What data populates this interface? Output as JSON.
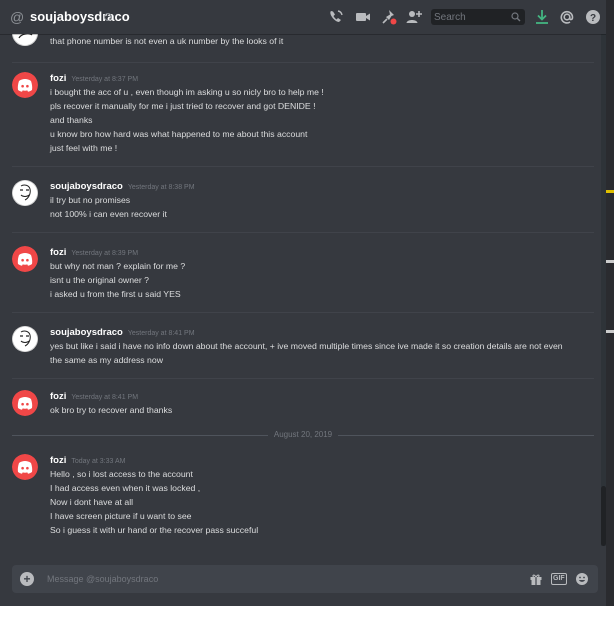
{
  "header": {
    "channel_name": "soujaboysdraco",
    "search_placeholder": "Search",
    "icons": [
      "at-icon",
      "status-icon",
      "phone-call-icon",
      "video-call-icon",
      "pin-icon",
      "add-friend-icon",
      "search-icon",
      "download-icon",
      "mentions-icon",
      "help-icon"
    ]
  },
  "messages": {
    "top_fragment": "that phone number is not even  a uk number by the looks of it",
    "groups": [
      {
        "author": "fozi",
        "timestamp": "Yesterday at 8:37 PM",
        "lines": [
          "i bought the acc of u , even though im asking u so nicly bro to help me !",
          "pls recover it manually for me i just tried to recover and got DENIDE  !",
          "and thanks",
          "u know bro how hard was what happened to me about this account",
          "just feel with me !"
        ]
      },
      {
        "author": "soujaboysdraco",
        "timestamp": "Yesterday at 8:38 PM",
        "lines": [
          "il try but no promises",
          "not 100% i can even recover it"
        ]
      },
      {
        "author": "fozi",
        "timestamp": "Yesterday at 8:39 PM",
        "lines": [
          "but why not man ? explain for me ?",
          "isnt u the original owner ?",
          "i asked u from the first u said YES"
        ]
      },
      {
        "author": "soujaboysdraco",
        "timestamp": "Yesterday at 8:41 PM",
        "lines": [
          "yes but like i said i have no info down about the account, + ive moved multiple times since ive made it so creation details are not even the same as my address now"
        ]
      },
      {
        "author": "fozi",
        "timestamp": "Yesterday at 8:41 PM",
        "lines": [
          "ok bro try to recover and thanks"
        ]
      },
      {
        "author": "fozi",
        "timestamp": "Today at 3:33 AM",
        "lines": [
          "Hello , so i lost access to the account",
          "I had access even when it was locked ,",
          "Now i dont have at all",
          "I have screen picture if u want to see",
          "So i guess it with ur hand or the recover pass succeful"
        ]
      }
    ],
    "date_separator": "August 20, 2019"
  },
  "composer": {
    "placeholder": "Message @soujaboysdraco",
    "gif_label": "GIF",
    "icons": [
      "upload-plus-icon",
      "gift-icon",
      "gif-icon",
      "emoji-icon"
    ]
  },
  "colors": {
    "background": "#36393f",
    "discord_avatar": "#f04747",
    "text": "#dcddde",
    "muted": "#72767d",
    "download_green": "#43b581"
  }
}
